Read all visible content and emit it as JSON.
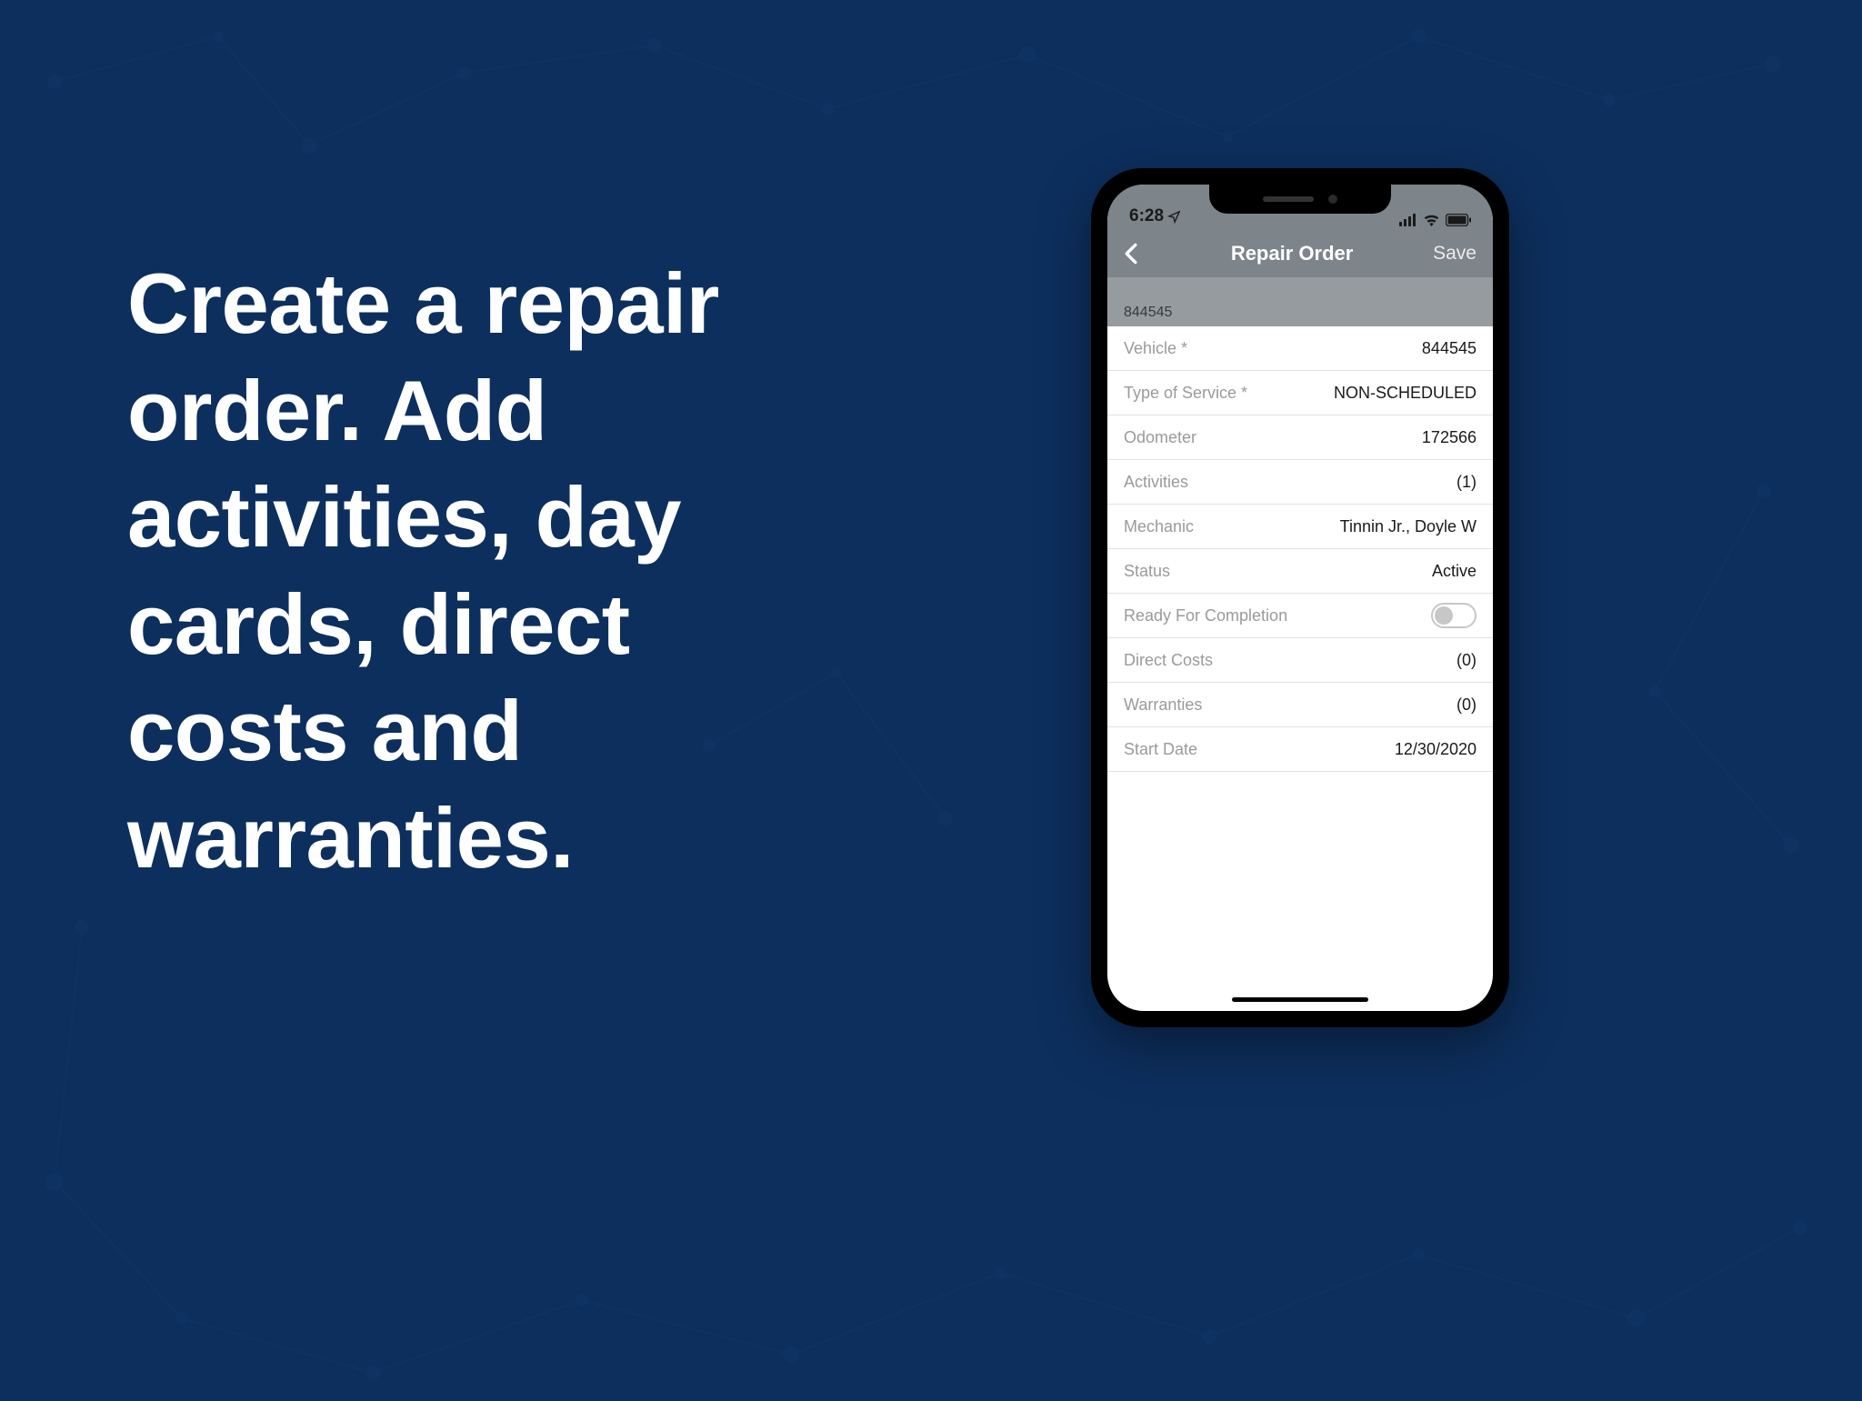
{
  "headline": "Create a repair order. Add activities, day cards, direct costs and warranties.",
  "statusBar": {
    "time": "6:28"
  },
  "navBar": {
    "title": "Repair Order",
    "save": "Save"
  },
  "sectionHeader": "844545",
  "form": {
    "vehicle": {
      "label": "Vehicle *",
      "value": "844545"
    },
    "typeOfService": {
      "label": "Type of Service *",
      "value": "NON-SCHEDULED"
    },
    "odometer": {
      "label": "Odometer",
      "value": "172566"
    },
    "activities": {
      "label": "Activities",
      "value": "(1)"
    },
    "mechanic": {
      "label": "Mechanic",
      "value": "Tinnin Jr., Doyle W"
    },
    "status": {
      "label": "Status",
      "value": "Active"
    },
    "readyForCompletion": {
      "label": "Ready For Completion"
    },
    "directCosts": {
      "label": "Direct Costs",
      "value": "(0)"
    },
    "warranties": {
      "label": "Warranties",
      "value": "(0)"
    },
    "startDate": {
      "label": "Start Date",
      "value": "12/30/2020"
    }
  }
}
